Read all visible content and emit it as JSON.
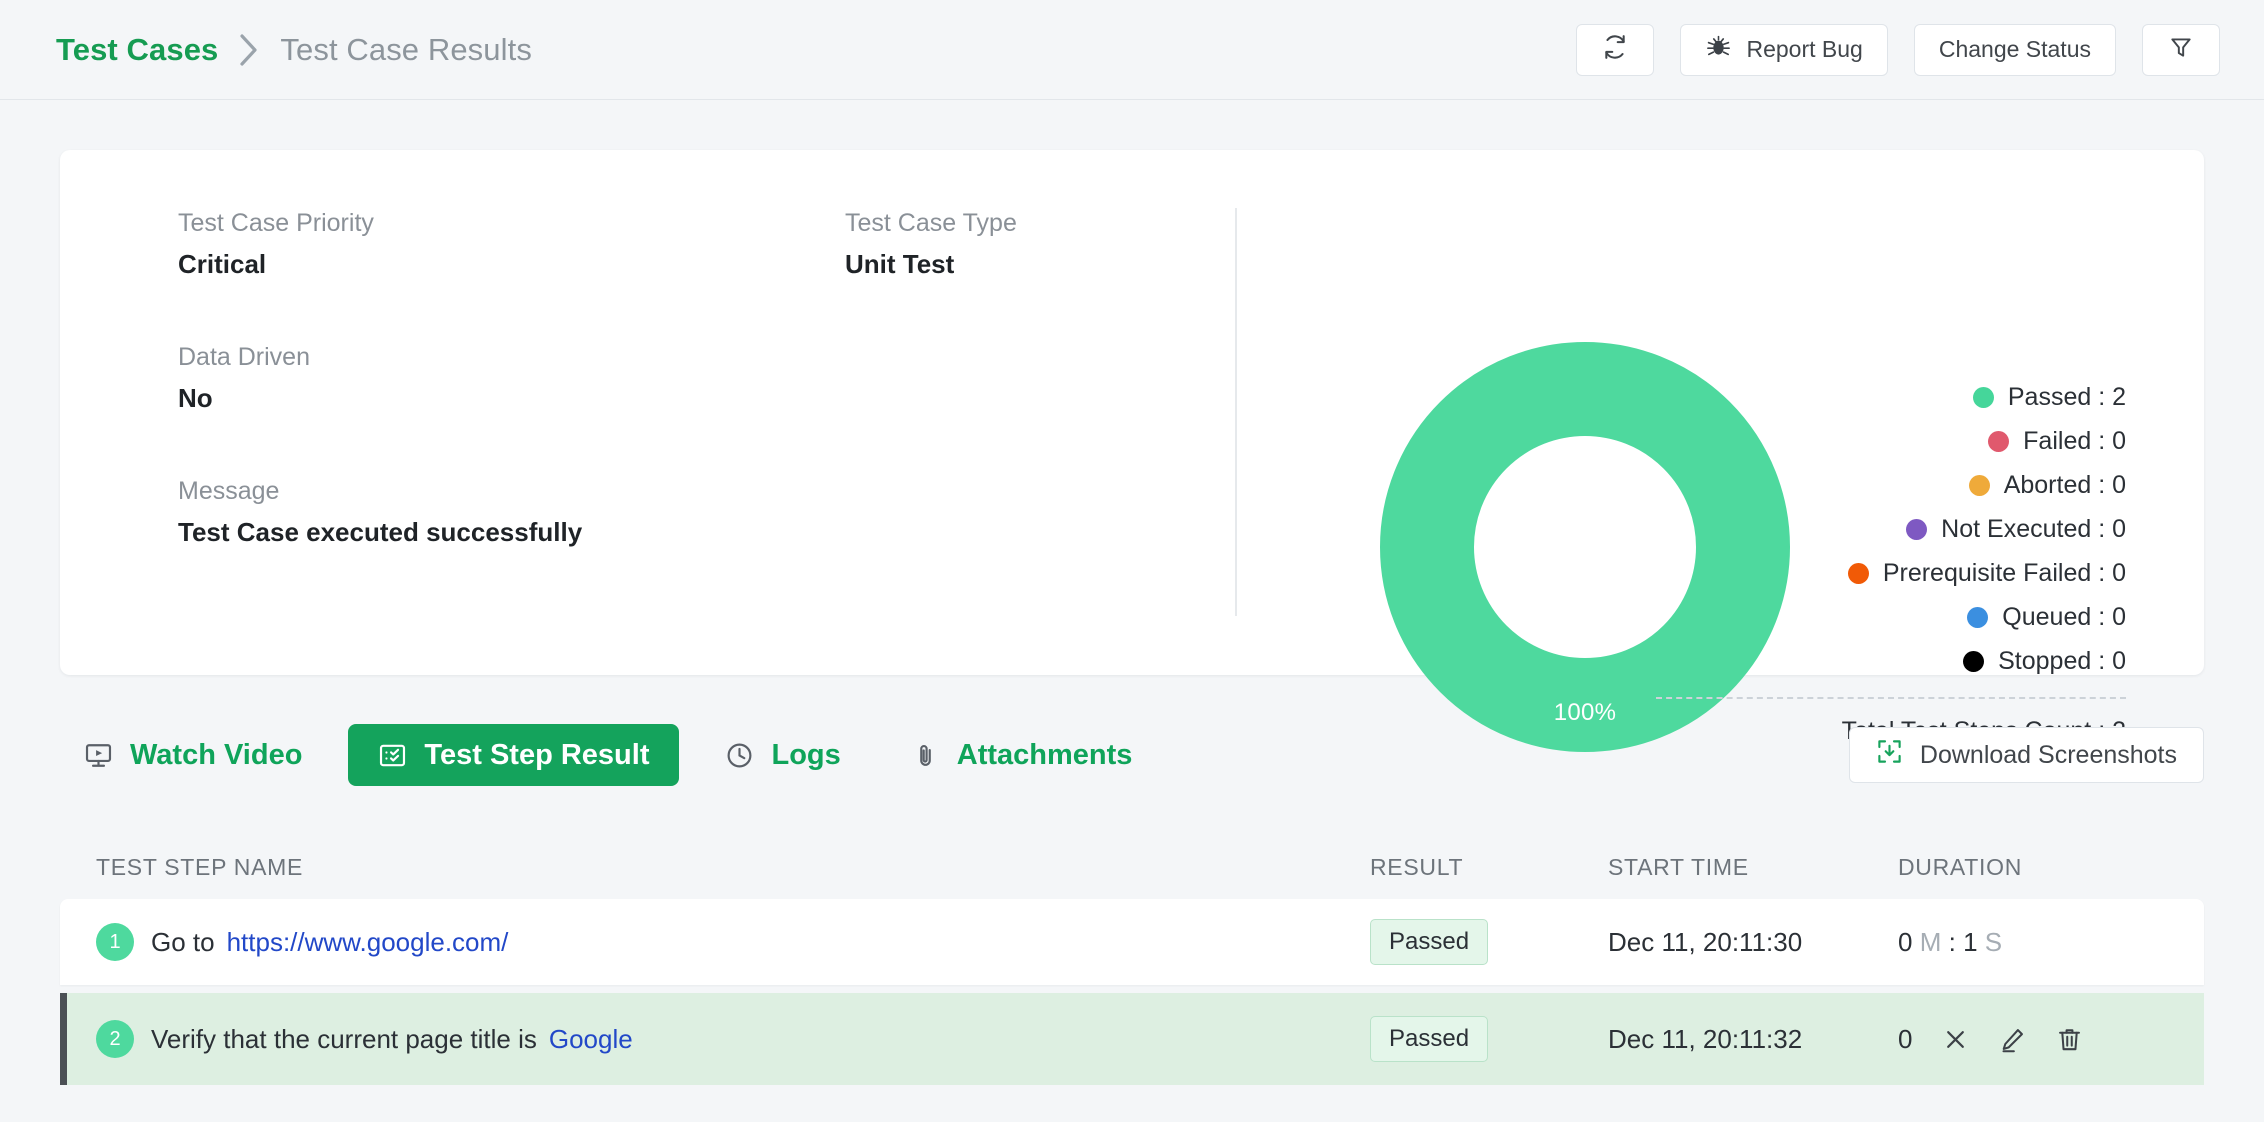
{
  "header": {
    "breadcrumb_root": "Test Cases",
    "breadcrumb_current": "Test Case Results",
    "actions": {
      "refresh_icon": "refresh-icon",
      "report_bug": "Report Bug",
      "bug_icon": "bug-icon",
      "change_status": "Change Status",
      "filter_icon": "filter-icon"
    }
  },
  "summary": {
    "fields": [
      {
        "label": "Test Case Priority",
        "value": "Critical"
      },
      {
        "label": "Data Driven",
        "value": "No"
      },
      {
        "label": "Message",
        "value": "Test Case executed successfully"
      },
      {
        "label": "Test Case Type",
        "value": "Unit Test"
      }
    ]
  },
  "chart_data": {
    "type": "pie",
    "title": "",
    "center_label": "100%",
    "categories": [
      "Passed",
      "Failed",
      "Aborted",
      "Not Executed",
      "Prerequisite Failed",
      "Queued",
      "Stopped"
    ],
    "values": [
      2,
      0,
      0,
      0,
      0,
      0,
      0
    ],
    "colors": [
      "#45d69a",
      "#e0596d",
      "#efaa3a",
      "#7e59c2",
      "#f15a06",
      "#3b8fe0",
      "#000000"
    ],
    "legend": [
      {
        "label": "Passed : 2",
        "color": "#45d69a"
      },
      {
        "label": "Failed : 0",
        "color": "#e0596d"
      },
      {
        "label": "Aborted : 0",
        "color": "#efaa3a"
      },
      {
        "label": "Not Executed : 0",
        "color": "#7e59c2"
      },
      {
        "label": "Prerequisite Failed : 0",
        "color": "#f15a06"
      },
      {
        "label": "Queued : 0",
        "color": "#3b8fe0"
      },
      {
        "label": "Stopped : 0",
        "color": "#000000"
      }
    ],
    "total_label": "Total Test Steps Count : 2",
    "legend_position": "right",
    "donut": true,
    "slice_percent": "100%"
  },
  "tabs": [
    {
      "label": "Watch Video",
      "icon": "monitor-play-icon",
      "active": false
    },
    {
      "label": "Test Step Result",
      "icon": "checklist-icon",
      "active": true
    },
    {
      "label": "Logs",
      "icon": "clock-icon",
      "active": false
    },
    {
      "label": "Attachments",
      "icon": "paperclip-icon",
      "active": false
    }
  ],
  "download_button": {
    "label": "Download Screenshots",
    "icon": "download-box-icon"
  },
  "table": {
    "columns": [
      "TEST STEP NAME",
      "RESULT",
      "START TIME",
      "DURATION"
    ],
    "rows": [
      {
        "num": "1",
        "text": "Go to",
        "link": "https://www.google.com/",
        "result": "Passed",
        "start_time": "Dec 11, 20:11:30",
        "duration_minutes": "0",
        "duration_m_unit": "M",
        "duration_sep": ":",
        "duration_seconds": "1",
        "duration_s_unit": "S"
      },
      {
        "num": "2",
        "text": "Verify that the current page title is",
        "link": "Google",
        "result": "Passed",
        "start_time": "Dec 11, 20:11:32",
        "duration_value": "0",
        "actions": [
          "close-icon",
          "edit-icon",
          "delete-icon"
        ]
      }
    ]
  },
  "colors": {
    "brand_green": "#14a35c",
    "link_blue": "#2248c8",
    "accent_green": "#4ed99e",
    "page_bg": "#f4f6f8"
  }
}
